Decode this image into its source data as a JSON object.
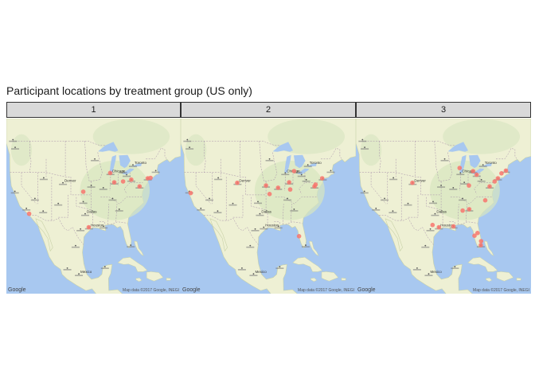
{
  "title": "Participant locations by treatment group (US only)",
  "map": {
    "google_label": "Google",
    "attribution": "Map data ©2017 Google, INEGI"
  },
  "city_labels": [
    "Chicago",
    "Denver",
    "Dallas",
    "Houston",
    "Mexico",
    "Toronto"
  ],
  "colors": {
    "point": "#f8766d",
    "water": "#a8c8f0",
    "land": "#eef0d4",
    "strip": "#d9d9d9"
  },
  "chart_data": {
    "type": "scatter",
    "facets": [
      {
        "label": "1",
        "points": [
          {
            "lon": -97.5,
            "lat": 37.7
          },
          {
            "lon": -117.2,
            "lat": 32.8
          },
          {
            "lon": -95.5,
            "lat": 29.8
          },
          {
            "lon": -87.7,
            "lat": 41.9
          },
          {
            "lon": -86.2,
            "lat": 39.8
          },
          {
            "lon": -83.0,
            "lat": 40.0
          },
          {
            "lon": -80.0,
            "lat": 40.4
          },
          {
            "lon": -77.0,
            "lat": 38.9
          },
          {
            "lon": -74.0,
            "lat": 40.7
          },
          {
            "lon": -73.0,
            "lat": 40.8
          }
        ]
      },
      {
        "label": "2",
        "points": [
          {
            "lon": -121.9,
            "lat": 37.4
          },
          {
            "lon": -105.0,
            "lat": 39.7
          },
          {
            "lon": -94.6,
            "lat": 39.1
          },
          {
            "lon": -93.3,
            "lat": 37.2
          },
          {
            "lon": -90.2,
            "lat": 38.6
          },
          {
            "lon": -85.8,
            "lat": 38.2
          },
          {
            "lon": -86.2,
            "lat": 39.8
          },
          {
            "lon": -84.4,
            "lat": 42.3
          },
          {
            "lon": -82.6,
            "lat": 27.8
          },
          {
            "lon": -77.0,
            "lat": 38.9
          },
          {
            "lon": -74.2,
            "lat": 40.7
          },
          {
            "lon": -76.6,
            "lat": 39.3
          }
        ]
      },
      {
        "label": "3",
        "points": [
          {
            "lon": -105.0,
            "lat": 39.7
          },
          {
            "lon": -97.7,
            "lat": 30.3
          },
          {
            "lon": -95.4,
            "lat": 29.8
          },
          {
            "lon": -90.1,
            "lat": 30.0
          },
          {
            "lon": -86.8,
            "lat": 33.5
          },
          {
            "lon": -87.9,
            "lat": 43.0
          },
          {
            "lon": -84.4,
            "lat": 33.8
          },
          {
            "lon": -84.5,
            "lat": 39.1
          },
          {
            "lon": -83.0,
            "lat": 42.3
          },
          {
            "lon": -81.7,
            "lat": 41.5
          },
          {
            "lon": -82.5,
            "lat": 27.9
          },
          {
            "lon": -81.4,
            "lat": 28.5
          },
          {
            "lon": -80.2,
            "lat": 25.8
          },
          {
            "lon": -80.1,
            "lat": 26.7
          },
          {
            "lon": -78.6,
            "lat": 35.8
          },
          {
            "lon": -77.0,
            "lat": 38.9
          },
          {
            "lon": -75.2,
            "lat": 40.0
          },
          {
            "lon": -74.0,
            "lat": 40.7
          },
          {
            "lon": -71.1,
            "lat": 42.4
          },
          {
            "lon": -72.7,
            "lat": 41.8
          }
        ]
      }
    ],
    "x_range": [
      -125.5,
      -62.0
    ],
    "y_range": [
      15.0,
      54.0
    ]
  }
}
